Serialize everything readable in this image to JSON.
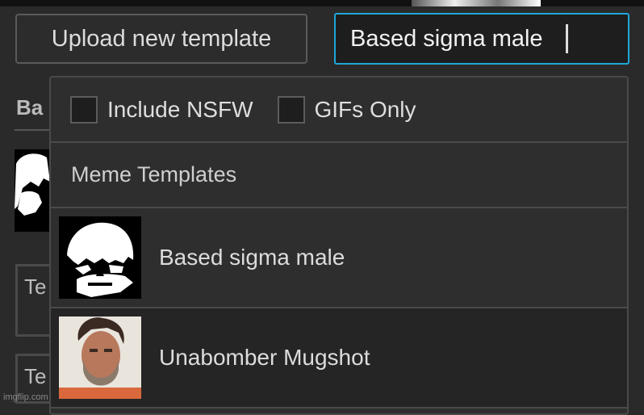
{
  "toolbar": {
    "upload_label": "Upload new template"
  },
  "search": {
    "value": "Based sigma male"
  },
  "background": {
    "heading_fragment": "Ba",
    "field_fragments": [
      "Te",
      "Te"
    ],
    "watermark": "imgflip.com"
  },
  "dropdown": {
    "filters": [
      {
        "label": "Include NSFW",
        "checked": false
      },
      {
        "label": "GIFs Only",
        "checked": false
      }
    ],
    "section_title": "Meme Templates",
    "results": [
      {
        "name": "Based sigma male",
        "icon": "sigma-male-face-thumbnail"
      },
      {
        "name": "Unabomber Mugshot",
        "icon": "mugshot-thumbnail"
      }
    ]
  },
  "colors": {
    "accent": "#1ea7d8",
    "background": "#2a2a2a",
    "panel": "#2e2e2e"
  }
}
